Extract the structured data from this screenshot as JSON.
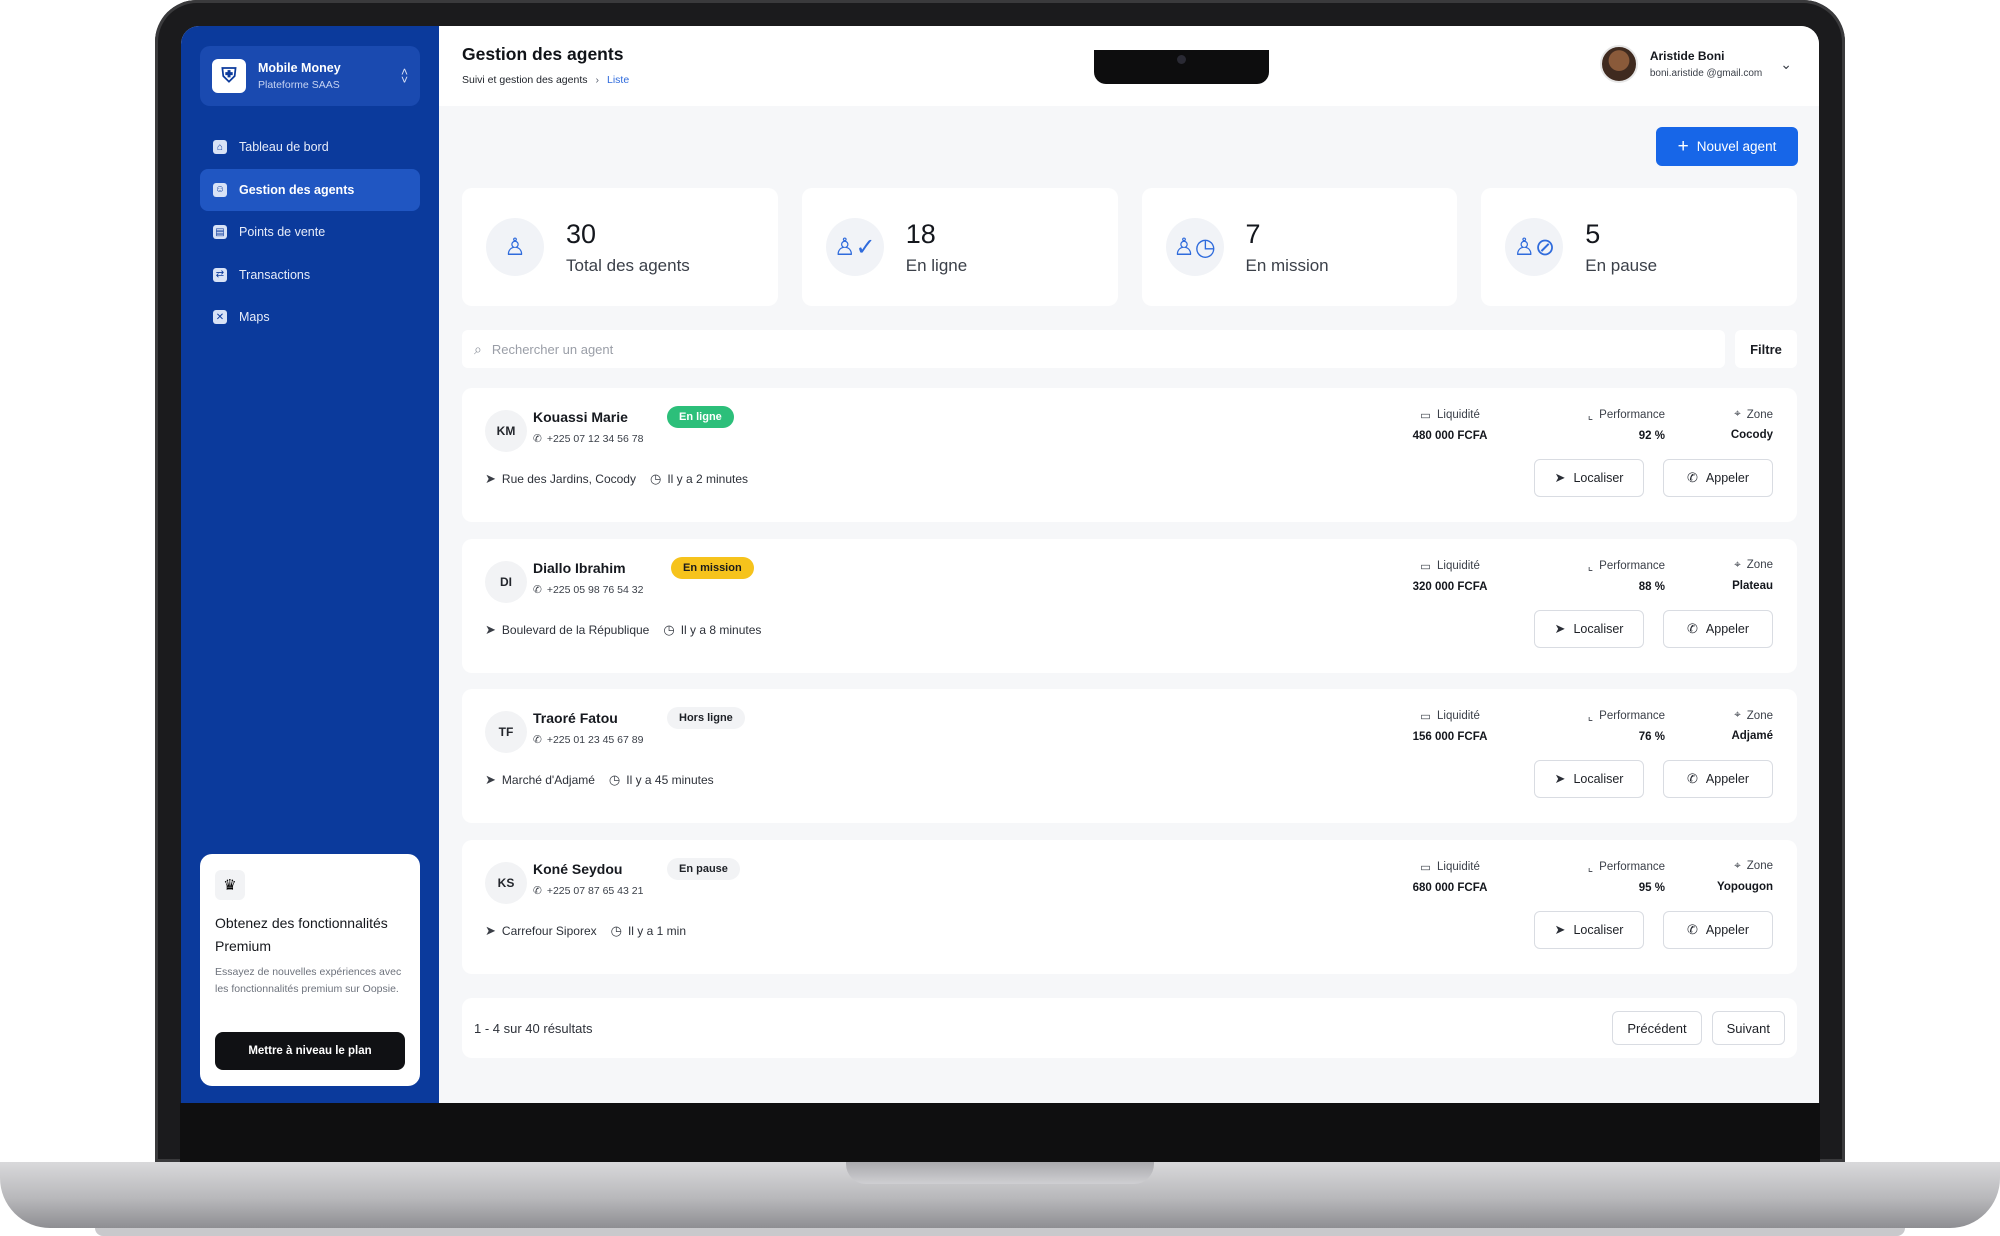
{
  "brand": {
    "name": "Mobile Money",
    "subtitle": "Plateforme SAAS"
  },
  "nav": [
    {
      "label": "Tableau de bord",
      "active": false
    },
    {
      "label": "Gestion des agents",
      "active": true
    },
    {
      "label": "Points de vente",
      "active": false
    },
    {
      "label": "Transactions",
      "active": false
    },
    {
      "label": "Maps",
      "active": false
    }
  ],
  "premium": {
    "title": "Obtenez des fonctionnalités Premium",
    "description": "Essayez de nouvelles expériences avec les fonctionnalités premium sur Oopsie.",
    "button": "Mettre à niveau le plan"
  },
  "header": {
    "title": "Gestion des agents",
    "breadcrumb": [
      "Suivi et gestion des agents",
      "Liste"
    ],
    "user_name": "Aristide Boni",
    "user_email": "boni.aristide @gmail.com"
  },
  "new_agent_button": "Nouvel agent",
  "stats": [
    {
      "value": "30",
      "label": "Total des agents",
      "icon": "user-icon"
    },
    {
      "value": "18",
      "label": "En ligne",
      "icon": "user-check-icon"
    },
    {
      "value": "7",
      "label": "En mission",
      "icon": "user-clock-icon"
    },
    {
      "value": "5",
      "label": "En pause",
      "icon": "user-pause-icon"
    }
  ],
  "search": {
    "placeholder": "Rechercher un agent",
    "filter_label": "Filtre"
  },
  "kpi_labels": {
    "liquidity": "Liquidité",
    "performance": "Performance",
    "zone": "Zone"
  },
  "action_labels": {
    "locate": "Localiser",
    "call": "Appeler"
  },
  "agents": [
    {
      "initials": "KM",
      "name": "Kouassi Marie",
      "phone": "+225 07 12 34 56 78",
      "status": "En ligne",
      "status_type": "online",
      "address": "Rue des Jardins, Cocody",
      "last_seen": "Il y a 2 minutes",
      "liquidity": "480 000 FCFA",
      "performance": "92 %",
      "zone": "Cocody"
    },
    {
      "initials": "DI",
      "name": "Diallo Ibrahim",
      "phone": "+225 05 98 76 54 32",
      "status": "En mission",
      "status_type": "mission",
      "address": "Boulevard de la République",
      "last_seen": "Il y a 8 minutes",
      "liquidity": "320 000 FCFA",
      "performance": "88 %",
      "zone": "Plateau"
    },
    {
      "initials": "TF",
      "name": "Traoré Fatou",
      "phone": "+225 01 23 45 67 89",
      "status": "Hors ligne",
      "status_type": "offline",
      "address": "Marché d'Adjamé",
      "last_seen": "Il y a 45 minutes",
      "liquidity": "156 000 FCFA",
      "performance": "76 %",
      "zone": "Adjamé"
    },
    {
      "initials": "KS",
      "name": "Koné Seydou",
      "phone": "+225 07 87 65 43 21",
      "status": "En pause",
      "status_type": "pause",
      "address": "Carrefour Siporex",
      "last_seen": "Il y a 1 min",
      "liquidity": "680 000 FCFA",
      "performance": "95 %",
      "zone": "Yopougon"
    }
  ],
  "pagination": {
    "info": "1 - 4 sur 40 résultats",
    "previous": "Précédent",
    "next": "Suivant"
  },
  "colors": {
    "sidebar": "#0b3a9c",
    "accent": "#1766e8",
    "online": "#2cbf7a",
    "mission": "#f6c31c"
  }
}
